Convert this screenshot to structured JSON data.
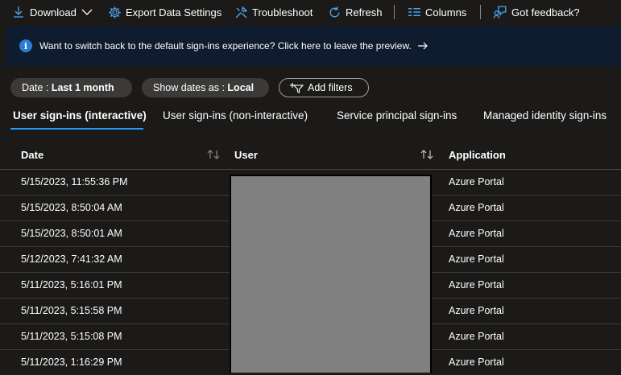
{
  "toolbar": {
    "download_label": "Download",
    "export_label": "Export Data Settings",
    "troubleshoot_label": "Troubleshoot",
    "refresh_label": "Refresh",
    "columns_label": "Columns",
    "feedback_label": "Got feedback?"
  },
  "banner": {
    "message": "Want to switch back to the default sign-ins experience? Click here to leave the preview."
  },
  "filters": {
    "date_prefix": "Date : ",
    "date_value": "Last 1 month",
    "show_dates_prefix": "Show dates as : ",
    "show_dates_value": "Local",
    "add_filters_label": "Add filters"
  },
  "tabs": [
    {
      "label": "User sign-ins (interactive)",
      "active": true
    },
    {
      "label": "User sign-ins (non-interactive)",
      "active": false
    },
    {
      "label": "Service principal sign-ins",
      "active": false
    },
    {
      "label": "Managed identity sign-ins",
      "active": false
    }
  ],
  "table": {
    "columns": [
      "Date",
      "User",
      "Application"
    ],
    "rows": [
      {
        "date": "5/15/2023, 11:55:36 PM",
        "application": "Azure Portal"
      },
      {
        "date": "5/15/2023, 8:50:04 AM",
        "application": "Azure Portal"
      },
      {
        "date": "5/15/2023, 8:50:01 AM",
        "application": "Azure Portal"
      },
      {
        "date": "5/12/2023, 7:41:32 AM",
        "application": "Azure Portal"
      },
      {
        "date": "5/11/2023, 5:16:01 PM",
        "application": "Azure Portal"
      },
      {
        "date": "5/11/2023, 5:15:58 PM",
        "application": "Azure Portal"
      },
      {
        "date": "5/11/2023, 5:15:08 PM",
        "application": "Azure Portal"
      },
      {
        "date": "5/11/2023, 1:16:29 PM",
        "application": "Azure Portal"
      }
    ]
  },
  "colors": {
    "background": "#1b1a19",
    "banner": "#0f1b2e",
    "accent": "#2899f5",
    "redaction": "#808080"
  }
}
